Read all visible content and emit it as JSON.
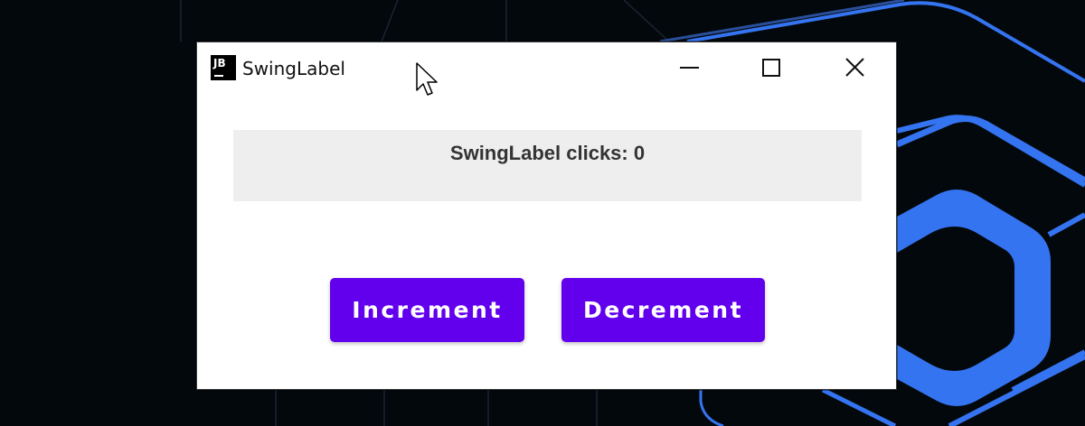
{
  "window": {
    "title": "SwingLabel",
    "icon_text": "JB",
    "controls": {
      "minimize_icon": "minimize-icon",
      "maximize_icon": "maximize-icon",
      "close_icon": "close-icon"
    }
  },
  "label": {
    "text": "SwingLabel clicks: 0"
  },
  "buttons": {
    "increment_label": "Increment",
    "decrement_label": "Decrement"
  },
  "colors": {
    "button_bg": "#6200ee",
    "button_text": "#ffffff",
    "label_bg": "#eeeeee",
    "desktop_bg": "#03080c",
    "desktop_accent": "#3574f0"
  }
}
